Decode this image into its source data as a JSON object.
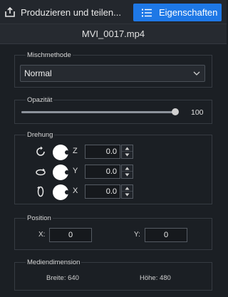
{
  "toolbar": {
    "share_label": "Produzieren und teilen...",
    "share_icon": "share-upload-icon",
    "properties_label": "Eigenschaften",
    "properties_icon": "list-icon",
    "accent_color": "#1e78e6"
  },
  "file": {
    "name": "MVI_0017.mp4"
  },
  "blend": {
    "label": "Mischmethode",
    "selected": "Normal",
    "icon": "chevron-down-icon"
  },
  "opacity": {
    "label": "Opazität",
    "value": "100",
    "fraction": 1.0
  },
  "rotation": {
    "label": "Drehung",
    "axes": [
      {
        "axis": "Z",
        "value": "0.0",
        "icon": "rotate-z-icon"
      },
      {
        "axis": "Y",
        "value": "0.0",
        "icon": "rotate-y-icon"
      },
      {
        "axis": "X",
        "value": "0.0",
        "icon": "rotate-x-icon"
      }
    ]
  },
  "position": {
    "label": "Position",
    "x_label": "X:",
    "x_value": "0",
    "y_label": "Y:",
    "y_value": "0"
  },
  "media": {
    "label": "Mediendimension",
    "width_text": "Breite: 640",
    "height_text": "Höhe: 480"
  }
}
